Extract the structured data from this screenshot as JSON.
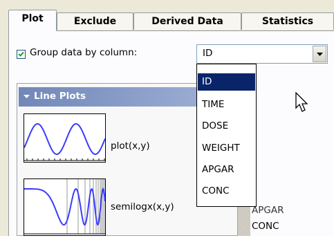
{
  "tabs": [
    {
      "label": "Plot",
      "active": true
    },
    {
      "label": "Exclude",
      "active": false
    },
    {
      "label": "Derived Data",
      "active": false
    },
    {
      "label": "Statistics",
      "active": false
    }
  ],
  "group": {
    "checked": true,
    "label": "Group data by column:",
    "selected": "ID"
  },
  "line_plots": {
    "title": "Line Plots",
    "items": [
      {
        "label": "plot(x,y)",
        "icon": "sine-plot-thumbnail-icon"
      },
      {
        "label": "semilogx(x,y)",
        "icon": "semilogx-plot-thumbnail-icon"
      }
    ]
  },
  "background_list": [
    "APGAR",
    "CONC"
  ],
  "dropdown": {
    "options": [
      "ID",
      "TIME",
      "DOSE",
      "WEIGHT",
      "APGAR",
      "CONC"
    ],
    "highlighted": "ID"
  },
  "colors": {
    "selection": "#0a246a",
    "panel_header": "#7087b8",
    "plot_line": "#3a3aff"
  }
}
